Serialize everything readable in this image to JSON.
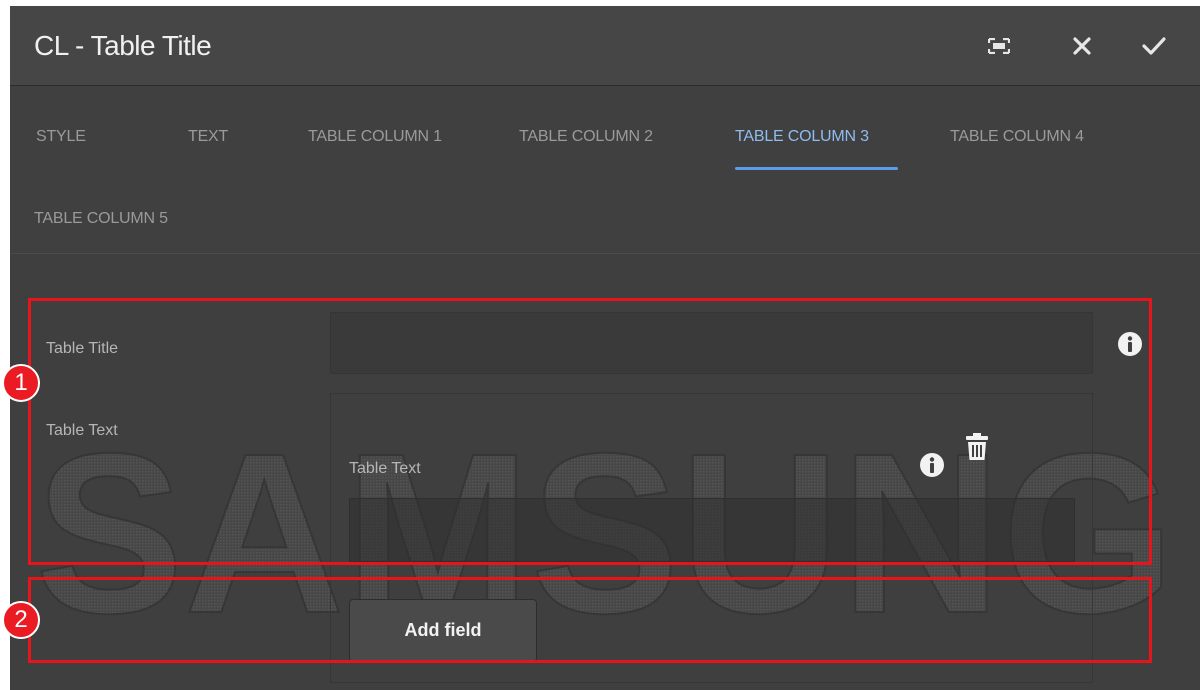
{
  "dialog": {
    "title": "CL - Table Title",
    "icons": [
      "fullscreen-icon",
      "close-icon",
      "check-icon"
    ]
  },
  "tabs": [
    {
      "label": "STYLE",
      "active": false
    },
    {
      "label": "TEXT",
      "active": false
    },
    {
      "label": "TABLE COLUMN 1",
      "active": false
    },
    {
      "label": "TABLE COLUMN 2",
      "active": false
    },
    {
      "label": "TABLE COLUMN 3",
      "active": true
    },
    {
      "label": "TABLE COLUMN 4",
      "active": false
    },
    {
      "label": "TABLE COLUMN 5",
      "active": false
    }
  ],
  "form": {
    "table_title_label": "Table Title",
    "table_title_value": "",
    "table_text_label": "Table Text",
    "item_label": "Table Text",
    "item_value": "",
    "add_button": "Add field"
  },
  "watermark": {
    "text": "SAMSUNG"
  },
  "annotations": {
    "badge1": "1",
    "badge2": "2"
  },
  "colors": {
    "highlight": "#e8141c",
    "active_tab": "#8fbcf0",
    "tab_underline": "#5c9ce8",
    "panel_bg": "#3f3f3f"
  }
}
